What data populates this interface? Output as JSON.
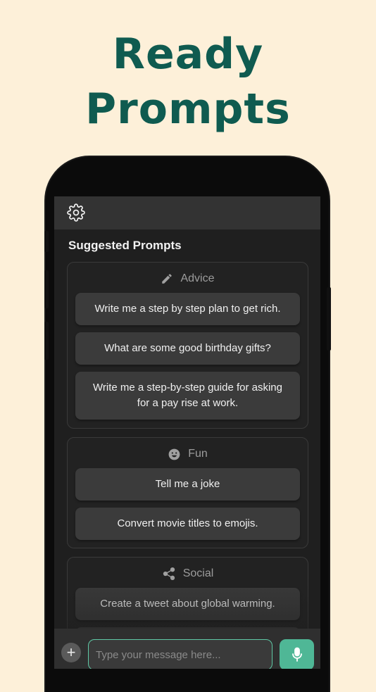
{
  "promo": {
    "line1": "Ready",
    "line2": "Prompts"
  },
  "colors": {
    "background": "#fdf0d9",
    "title": "#0f5b50",
    "accent": "#4fb796"
  },
  "header": {
    "settings_icon": "gear-icon"
  },
  "suggested": {
    "heading": "Suggested Prompts",
    "categories": [
      {
        "name": "Advice",
        "icon": "pencil-icon",
        "prompts": [
          "Write me a step by step plan to get rich.",
          "What are some good birthday gifts?",
          "Write me a step-by-step guide for asking for a pay rise at work."
        ]
      },
      {
        "name": "Fun",
        "icon": "smiley-icon",
        "prompts": [
          "Tell me a joke",
          "Convert movie titles to emojis."
        ]
      },
      {
        "name": "Social",
        "icon": "share-icon",
        "prompts": [
          "Create a tweet about global warming."
        ]
      }
    ]
  },
  "composer": {
    "add_icon": "plus-icon",
    "placeholder": "Type your message here...",
    "mic_icon": "microphone-icon"
  }
}
